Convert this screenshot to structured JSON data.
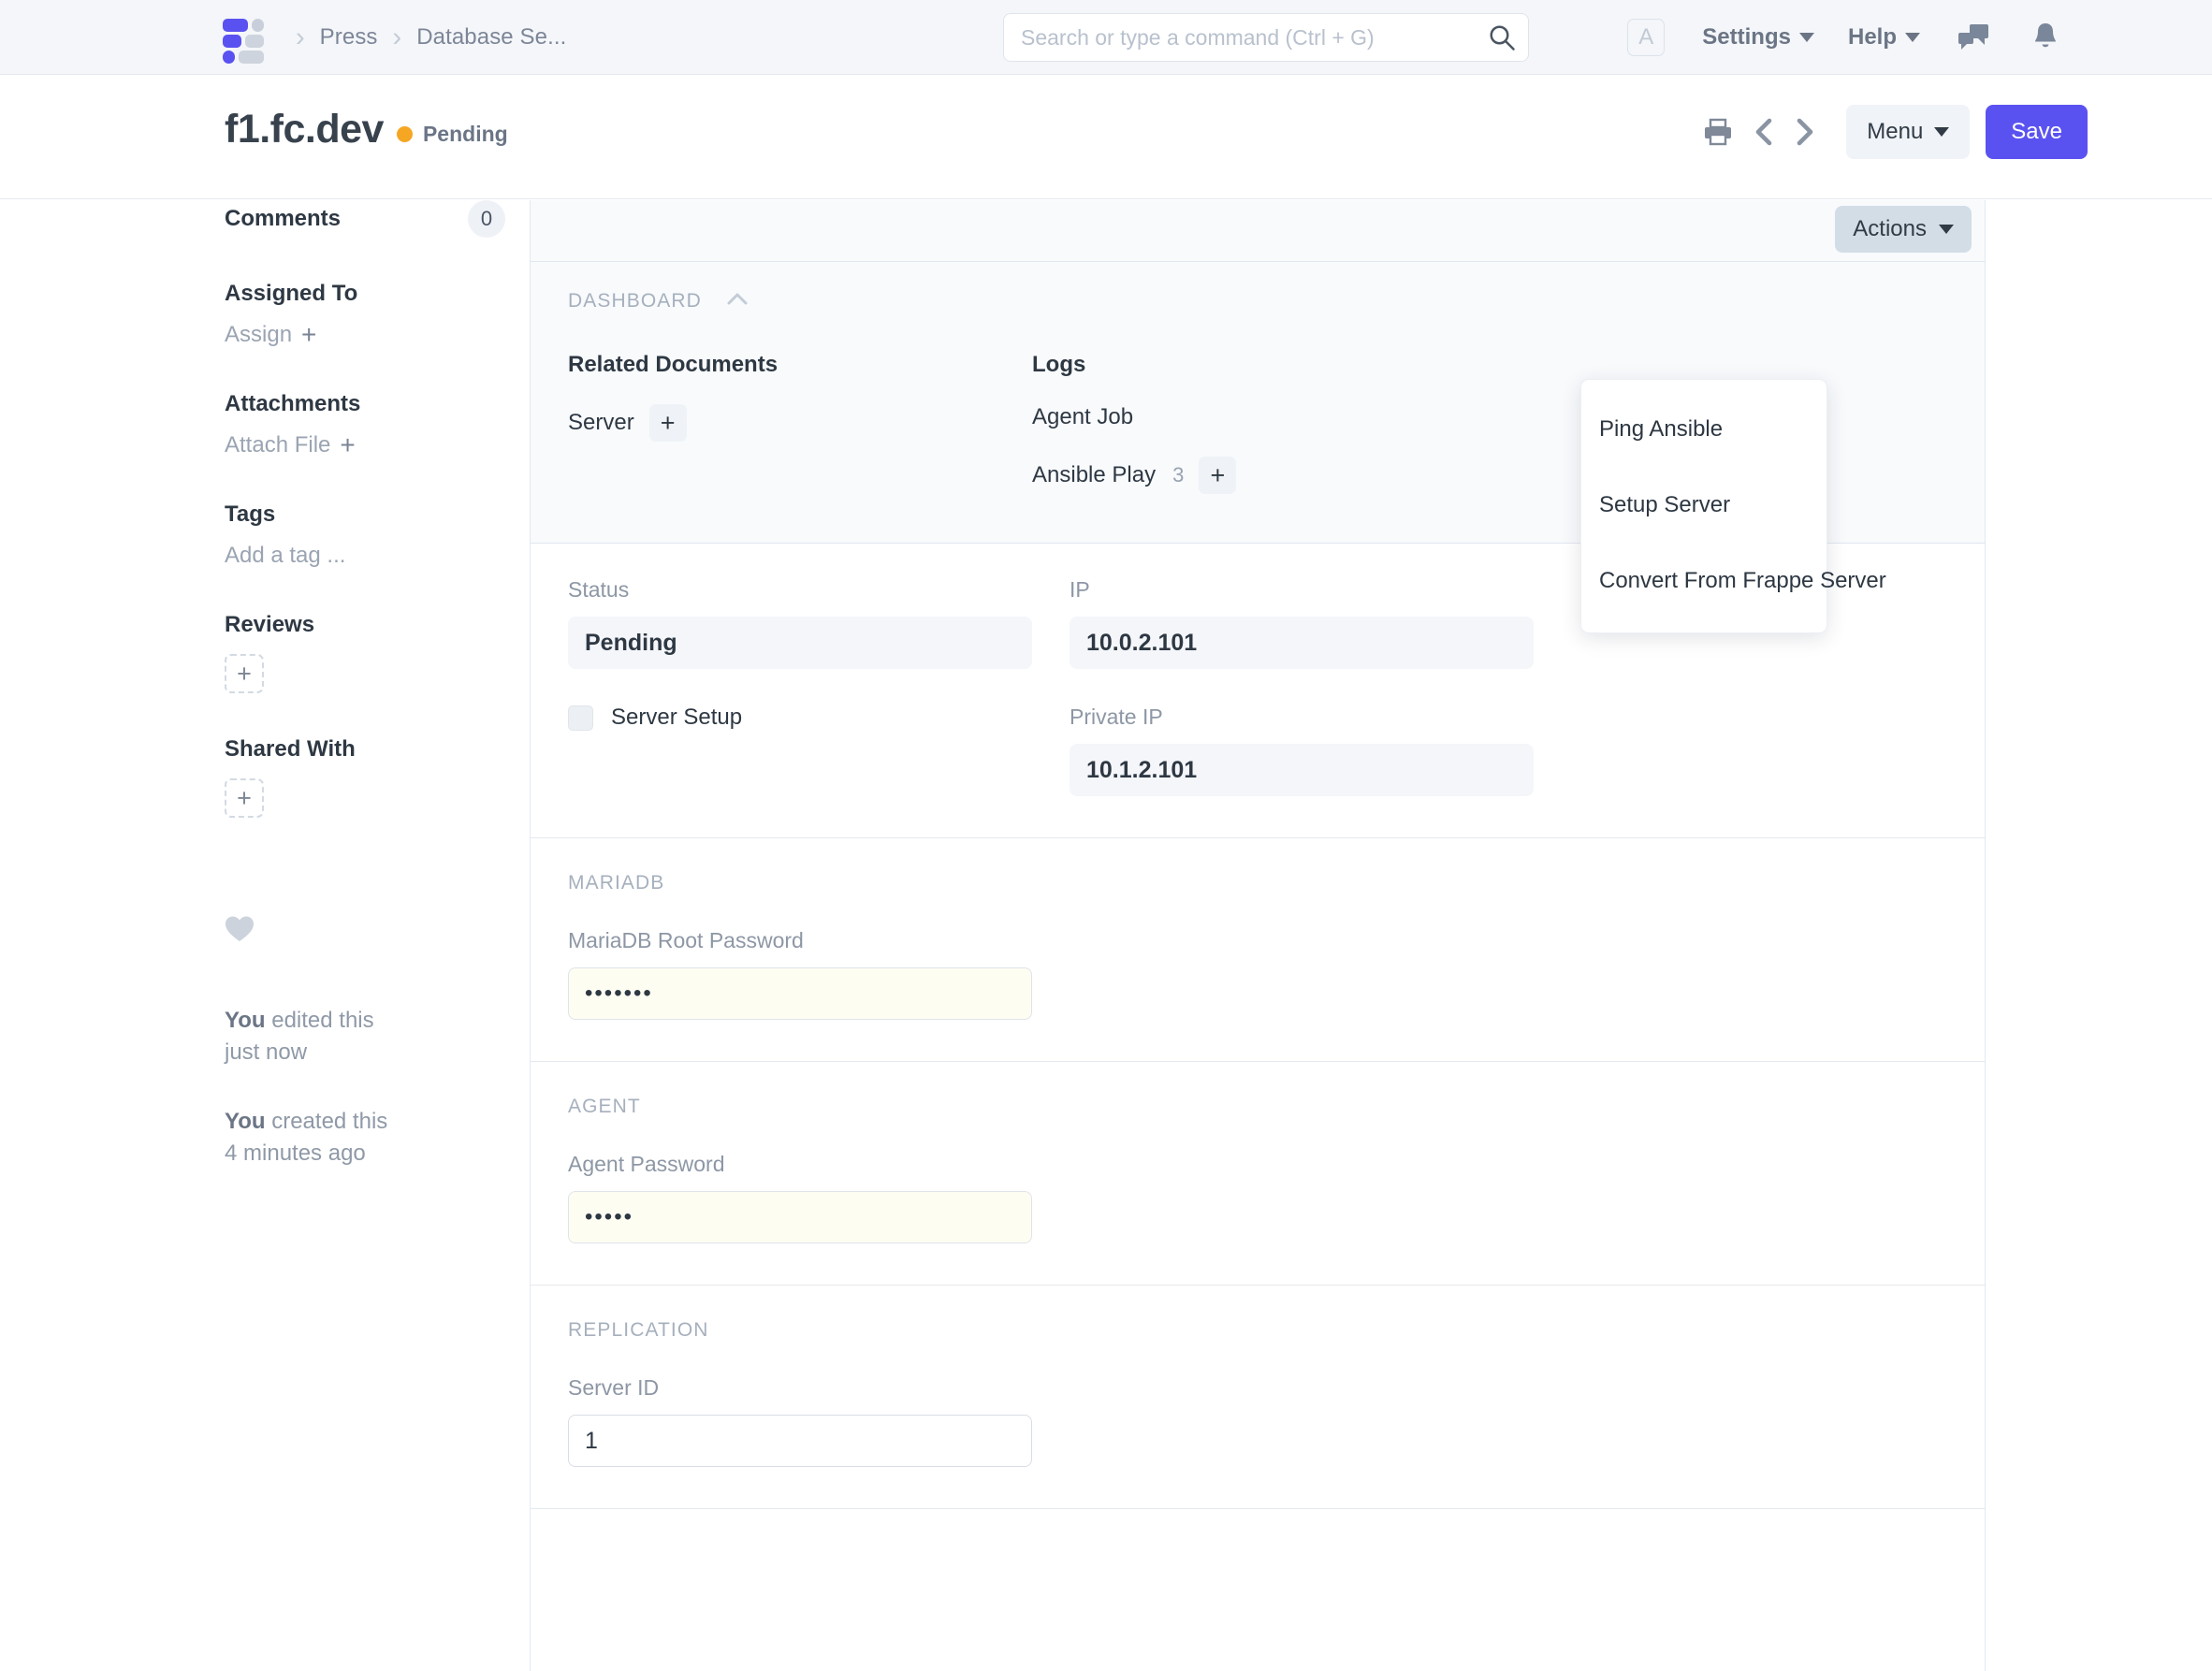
{
  "navbar": {
    "breadcrumbs": [
      "Press",
      "Database Se..."
    ],
    "search": {
      "placeholder": "Search or type a command (Ctrl + G)",
      "value": ""
    },
    "avatar_initial": "A",
    "settings_label": "Settings",
    "help_label": "Help"
  },
  "pagehead": {
    "title": "f1.fc.dev",
    "status": "Pending",
    "status_color": "#f5a623",
    "menu_label": "Menu",
    "save_label": "Save",
    "save_color": "#5a52f0"
  },
  "sidebar": {
    "comments": {
      "label": "Comments",
      "count": "0"
    },
    "assigned_to": {
      "label": "Assigned To",
      "action": "Assign"
    },
    "attachments": {
      "label": "Attachments",
      "action": "Attach File"
    },
    "tags": {
      "label": "Tags",
      "action": "Add a tag ..."
    },
    "reviews": {
      "label": "Reviews"
    },
    "shared_with": {
      "label": "Shared With"
    },
    "activity": [
      {
        "who": "You",
        "what": " edited this",
        "when": "just now"
      },
      {
        "who": "You",
        "what": " created this",
        "when": "4 minutes ago"
      }
    ]
  },
  "panel": {
    "actions_label": "Actions",
    "actions_menu": [
      "Ping Ansible",
      "Setup Server",
      "Convert From Frappe Server"
    ],
    "dashboard": {
      "label": "DASHBOARD",
      "related_documents": {
        "heading": "Related Documents",
        "items": [
          {
            "label": "Server",
            "count": ""
          }
        ]
      },
      "logs": {
        "heading": "Logs",
        "items": [
          {
            "label": "Agent Job",
            "count": ""
          },
          {
            "label": "Ansible Play",
            "count": "3"
          }
        ]
      }
    },
    "sections": {
      "status_ip": {
        "status": {
          "label": "Status",
          "value": "Pending"
        },
        "server_setup": {
          "label": "Server Setup",
          "checked": false
        },
        "ip": {
          "label": "IP",
          "value": "10.0.2.101"
        },
        "private_ip": {
          "label": "Private IP",
          "value": "10.1.2.101"
        }
      },
      "mariadb": {
        "label": "MARIADB",
        "root_password": {
          "label": "MariaDB Root Password",
          "value": "•••••••"
        }
      },
      "agent": {
        "label": "AGENT",
        "password": {
          "label": "Agent Password",
          "value": "•••••"
        }
      },
      "replication": {
        "label": "REPLICATION",
        "server_id": {
          "label": "Server ID",
          "value": "1"
        }
      }
    }
  }
}
